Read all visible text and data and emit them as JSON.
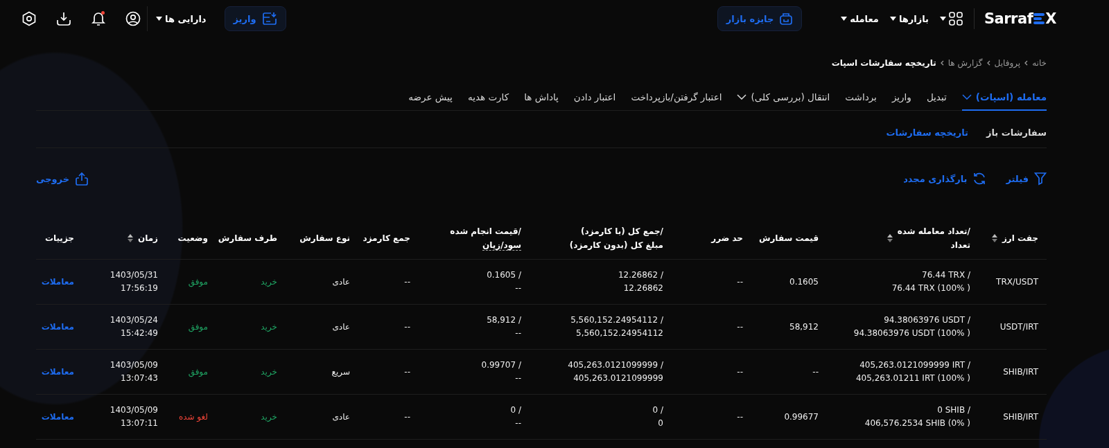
{
  "header": {
    "logo": {
      "text_start": "Sarraf",
      "text_end": "X"
    },
    "nav": [
      {
        "label": "بازارها"
      },
      {
        "label": "معامله"
      }
    ],
    "prize_button": "جایزه بازار",
    "deposit_button": "واریز",
    "assets_menu": "دارایی ها",
    "has_unread": true
  },
  "breadcrumb": [
    "خانه",
    "پروفایل",
    "گزارش ها",
    "تاریخچه سفارشات اسپات"
  ],
  "tabs": [
    {
      "label": "معامله (اسپات)",
      "selected": true,
      "has_menu": true
    },
    {
      "label": "تبدیل",
      "selected": false,
      "has_menu": false
    },
    {
      "label": "واریز",
      "selected": false,
      "has_menu": false
    },
    {
      "label": "برداشت",
      "selected": false,
      "has_menu": false
    },
    {
      "label": "انتقال (بررسی کلی)",
      "selected": false,
      "has_menu": true
    },
    {
      "label": "اعتبار گرفتن/بازپرداخت",
      "selected": false,
      "has_menu": false
    },
    {
      "label": "اعتبار دادن",
      "selected": false,
      "has_menu": false
    },
    {
      "label": "پاداش ها",
      "selected": false,
      "has_menu": false
    },
    {
      "label": "کارت هدیه",
      "selected": false,
      "has_menu": false
    },
    {
      "label": "پیش عرضه",
      "selected": false,
      "has_menu": false
    }
  ],
  "subtabs": [
    {
      "label": "سفارشات باز",
      "selected": false
    },
    {
      "label": "تاریخچه سفارشات",
      "selected": true
    }
  ],
  "toolbar": {
    "filter": "فیلتر",
    "reload": "بارگذاری مجدد",
    "export": "خروجی"
  },
  "table": {
    "columns": [
      {
        "lines": [
          "جفت ارز"
        ],
        "sortable": true,
        "hint": false
      },
      {
        "lines": [
          "/تعداد معامله شده",
          "تعداد"
        ],
        "sortable": true,
        "hint": false
      },
      {
        "lines": [
          "قیمت سفارش"
        ],
        "sortable": false,
        "hint": false
      },
      {
        "lines": [
          "حد ضرر"
        ],
        "sortable": false,
        "hint": false
      },
      {
        "lines": [
          "/جمع کل (با کارمزد)",
          "مبلغ کل (بدون کارمزد)"
        ],
        "sortable": false,
        "hint": false
      },
      {
        "lines": [
          "/قیمت انجام شده",
          "سود/زیان"
        ],
        "sortable": false,
        "hint": true
      },
      {
        "lines": [
          "جمع کارمزد"
        ],
        "sortable": false,
        "hint": false
      },
      {
        "lines": [
          "نوع سفارش"
        ],
        "sortable": false,
        "hint": false
      },
      {
        "lines": [
          "طرف سفارش"
        ],
        "sortable": false,
        "hint": false
      },
      {
        "lines": [
          "وضعیت"
        ],
        "sortable": false,
        "hint": false
      },
      {
        "lines": [
          "زمان"
        ],
        "sortable": true,
        "hint": false
      },
      {
        "lines": [
          "جزییات"
        ],
        "sortable": false,
        "hint": false
      }
    ],
    "rows": [
      [
        {
          "lines": [
            "TRX/USDT"
          ]
        },
        {
          "lines": [
            "76.44 TRX /",
            "76.44 TRX (100% )"
          ]
        },
        {
          "lines": [
            "0.1605"
          ]
        },
        {
          "lines": [
            "--"
          ]
        },
        {
          "lines": [
            "12.26862 /",
            "12.26862"
          ]
        },
        {
          "lines": [
            "0.1605 /",
            "--"
          ]
        },
        {
          "lines": [
            "--"
          ]
        },
        {
          "lines": [
            "عادی"
          ]
        },
        {
          "lines": [
            "خرید"
          ],
          "kind": "success"
        },
        {
          "lines": [
            "موفق"
          ],
          "kind": "success"
        },
        {
          "lines": [
            "1403/05/31",
            "17:56:19"
          ]
        },
        {
          "lines": [
            "معاملات"
          ],
          "kind": "link"
        }
      ],
      [
        {
          "lines": [
            "USDT/IRT"
          ]
        },
        {
          "lines": [
            "94.38063976 USDT /",
            "94.38063976 USDT (100% )"
          ]
        },
        {
          "lines": [
            "58,912"
          ]
        },
        {
          "lines": [
            "--"
          ]
        },
        {
          "lines": [
            "5,560,152.24954112 /",
            "5,560,152.24954112"
          ]
        },
        {
          "lines": [
            "58,912 /",
            "--"
          ]
        },
        {
          "lines": [
            "--"
          ]
        },
        {
          "lines": [
            "عادی"
          ]
        },
        {
          "lines": [
            "خرید"
          ],
          "kind": "success"
        },
        {
          "lines": [
            "موفق"
          ],
          "kind": "success"
        },
        {
          "lines": [
            "1403/05/24",
            "15:42:49"
          ]
        },
        {
          "lines": [
            "معاملات"
          ],
          "kind": "link"
        }
      ],
      [
        {
          "lines": [
            "SHIB/IRT"
          ]
        },
        {
          "lines": [
            "405,263.0121099999 IRT /",
            "405,263.01211 IRT (100% )"
          ]
        },
        {
          "lines": [
            "--"
          ]
        },
        {
          "lines": [
            "--"
          ]
        },
        {
          "lines": [
            "405,263.0121099999 /",
            "405,263.0121099999"
          ]
        },
        {
          "lines": [
            "0.99707 /",
            "--"
          ]
        },
        {
          "lines": [
            "--"
          ]
        },
        {
          "lines": [
            "سریع"
          ]
        },
        {
          "lines": [
            "خرید"
          ],
          "kind": "success"
        },
        {
          "lines": [
            "موفق"
          ],
          "kind": "success"
        },
        {
          "lines": [
            "1403/05/09",
            "13:07:43"
          ]
        },
        {
          "lines": [
            "معاملات"
          ],
          "kind": "link"
        }
      ],
      [
        {
          "lines": [
            "SHIB/IRT"
          ]
        },
        {
          "lines": [
            "0 SHIB /",
            "406,576.2534 SHIB (0% )"
          ]
        },
        {
          "lines": [
            "0.99677"
          ]
        },
        {
          "lines": [
            "--"
          ]
        },
        {
          "lines": [
            "0 /",
            "0"
          ]
        },
        {
          "lines": [
            "0 /",
            "--"
          ]
        },
        {
          "lines": [
            "--"
          ]
        },
        {
          "lines": [
            "عادی"
          ]
        },
        {
          "lines": [
            "خرید"
          ],
          "kind": "success"
        },
        {
          "lines": [
            "لغو شده"
          ],
          "kind": "danger"
        },
        {
          "lines": [
            "1403/05/09",
            "13:07:11"
          ]
        },
        {
          "lines": [
            "معاملات"
          ],
          "kind": "link"
        }
      ]
    ]
  }
}
